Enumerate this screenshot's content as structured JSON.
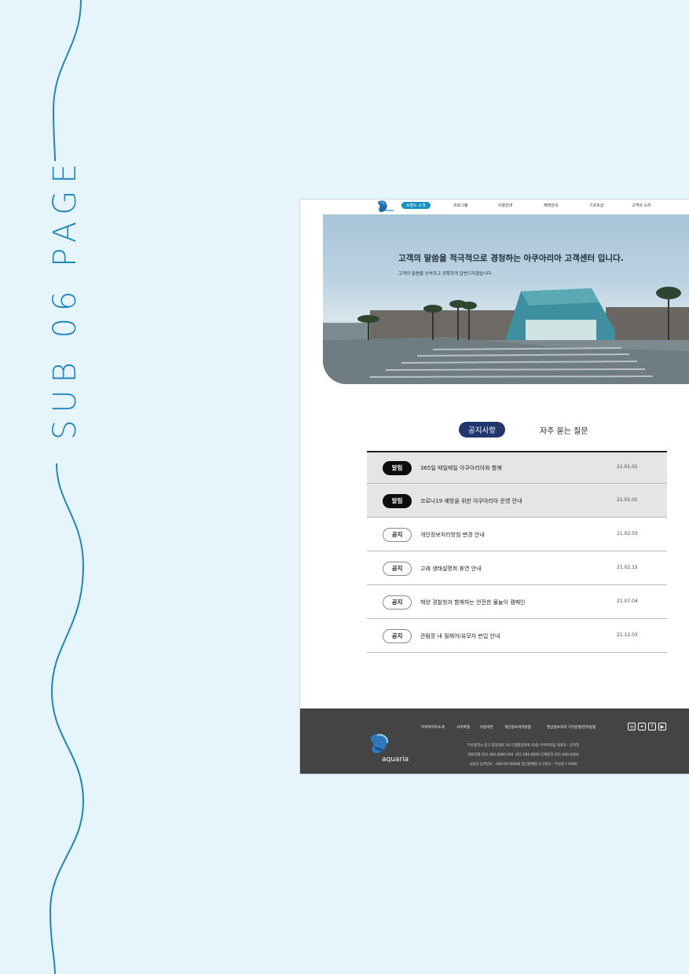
{
  "side_title": "SUB 06 PAGE",
  "colors": {
    "background": "#e6f4fc",
    "accent": "#1f86c0",
    "nav_active": "#1791c2",
    "tab_active": "#20366d",
    "footer": "#444444"
  },
  "nav": {
    "items": [
      "브랜드 소개",
      "프로그램",
      "이용안내",
      "혜택안내",
      "기프트샵",
      "고객의 소리"
    ],
    "active": "브랜드 소개"
  },
  "hero": {
    "headline": "고객의 말씀을 적극적으로 경청하는 아쿠아리아 고객센터 입니다.",
    "subtext": "고객의 말씀을 신속하고 정확하게 답변드리겠습니다"
  },
  "tabs": [
    "공지사항",
    "자주 묻는 질문"
  ],
  "notices": [
    {
      "badge": "알림",
      "title": "365일 매일매일 아쿠아리아와 함께",
      "date": "21.01.01"
    },
    {
      "badge": "알림",
      "title": "코로나19 예방을 위한 아쿠아리아 운영 안내",
      "date": "21.01.01"
    },
    {
      "badge": "공지",
      "title": "개인정보처리방침 변경 안내",
      "date": "21.02.03"
    },
    {
      "badge": "공지",
      "title": "고래 생태설명회 휴연 안내",
      "date": "21.02.15"
    },
    {
      "badge": "공지",
      "title": "해양 경찰청과 함께하는 안전한 물놀이 캠페인",
      "date": "21.07.04"
    },
    {
      "badge": "공지",
      "title": "관람장 내 휠체어/유모차 반입 안내",
      "date": "21.12.03"
    }
  ],
  "footer": {
    "logo_text": "aquaria",
    "links": [
      "아쿠아리아소개",
      "사이트맵",
      "이용약관",
      "개인정보처리방침",
      "영상정보처리 기기운영/관리방침"
    ],
    "social_icons": [
      "instagram-icon",
      "twitter-icon",
      "facebook-icon",
      "youtube-icon"
    ],
    "address": "부산광역시 중구 중앙대로 26 디엠중앙타워 10층 아쿠아리움 대표자 : 김하연",
    "contact": "대표전화 051.000.0000  FAX. 051.000.0000  단체문의 051.000.0000",
    "registration": "사업자 등록번호 : 000-00-00000 통신판매업 신고번호 : 부산중구 0000"
  }
}
